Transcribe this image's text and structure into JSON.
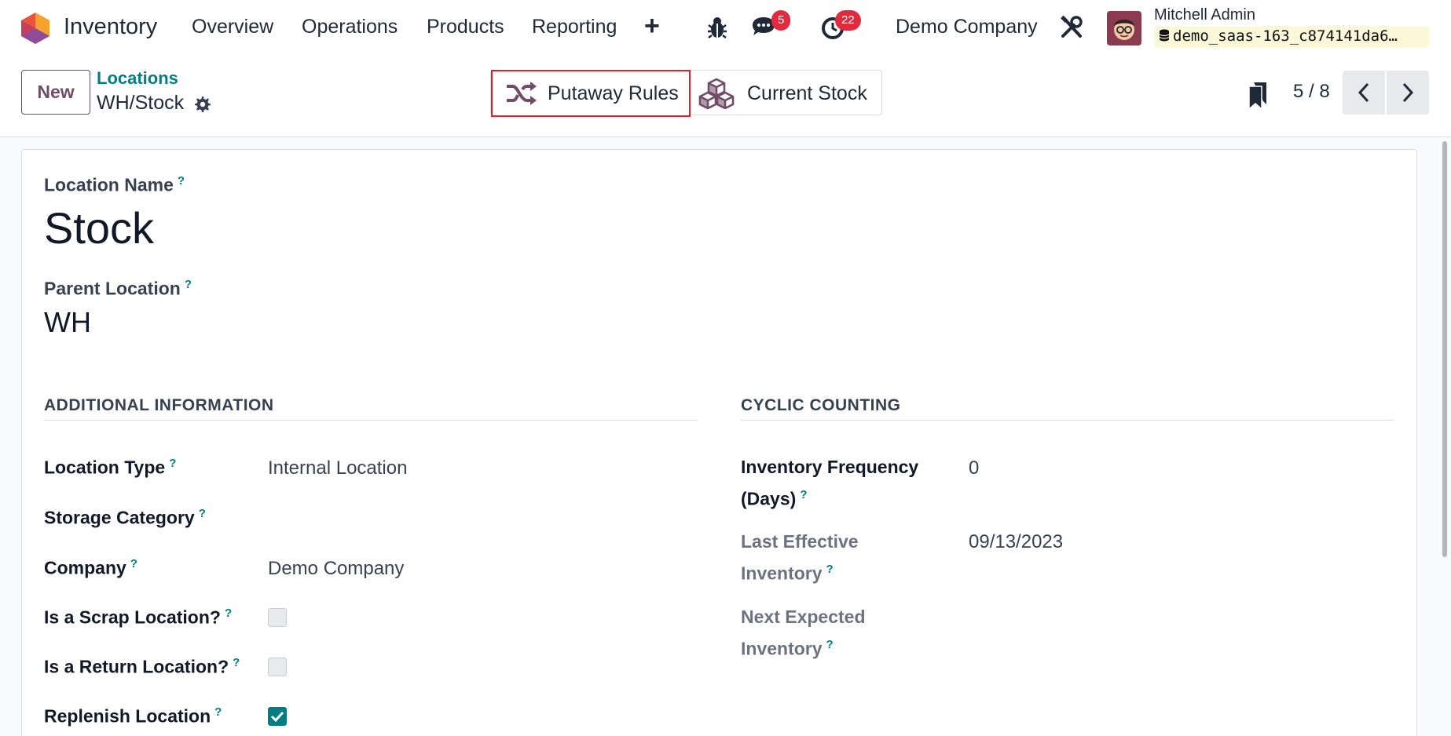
{
  "navbar": {
    "app_name": "Inventory",
    "menu": [
      "Overview",
      "Operations",
      "Products",
      "Reporting"
    ],
    "plus_label": "+",
    "messages_count": "5",
    "activities_count": "22",
    "company": "Demo Company",
    "user_name": "Mitchell Admin",
    "database": "demo_saas-163_c874141da6…"
  },
  "control": {
    "new_label": "New",
    "breadcrumb_parent": "Locations",
    "breadcrumb_current": "WH/Stock",
    "smart_buttons": [
      {
        "label": "Putaway Rules",
        "icon": "shuffle-icon"
      },
      {
        "label": "Current Stock",
        "icon": "cubes-icon"
      }
    ],
    "pager": "5 / 8"
  },
  "form": {
    "location_name_label": "Location Name",
    "location_name": "Stock",
    "parent_location_label": "Parent Location",
    "parent_location": "WH",
    "help_mark": "?",
    "additional_info": {
      "title": "ADDITIONAL INFORMATION",
      "location_type_label": "Location Type",
      "location_type": "Internal Location",
      "storage_category_label": "Storage Category",
      "storage_category": "",
      "company_label": "Company",
      "company": "Demo Company",
      "scrap_label": "Is a Scrap Location?",
      "scrap_checked": false,
      "return_label": "Is a Return Location?",
      "return_checked": false,
      "replenish_label": "Replenish Location",
      "replenish_checked": true
    },
    "cyclic_counting": {
      "title": "CYCLIC COUNTING",
      "frequency_label_1": "Inventory Frequency",
      "frequency_label_2": "(Days)",
      "frequency": "0",
      "last_label_1": "Last Effective",
      "last_label_2": "Inventory",
      "last_date": "09/13/2023",
      "next_label_1": "Next Expected",
      "next_label_2": "Inventory",
      "next_date": ""
    }
  },
  "colors": {
    "brand": "#714b67",
    "accent": "#017e84",
    "badge": "#e02a3e",
    "highlight": "#e0202d"
  }
}
